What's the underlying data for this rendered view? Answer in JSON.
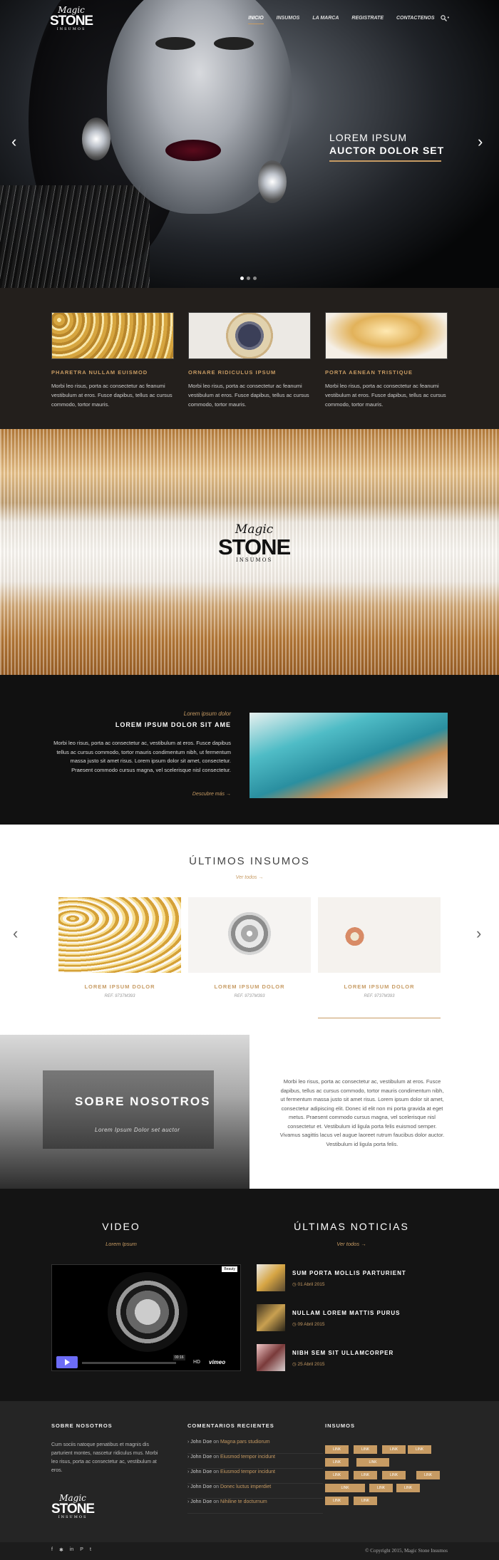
{
  "brand": {
    "line1": "Magic",
    "line2": "STONE",
    "line3": "INSUMOS"
  },
  "nav": {
    "items": [
      "INICIO",
      "INSUMOS",
      "LA MARCA",
      "REGISTRATE",
      "CONTACTENOS"
    ],
    "extra": "•"
  },
  "hero": {
    "title1": "LOREM IPSUM",
    "title2": "AUCTOR DOLOR SET",
    "prev": "‹",
    "next": "›"
  },
  "features": [
    {
      "title": "PHARETRA NULLAM EUISMOD",
      "text": "Morbi leo risus, porta ac consectetur ac feanumi vestibulum at eros. Fusce dapibus, tellus ac cursus commodo, tortor mauris."
    },
    {
      "title": "ORNARE RIDICULUS IPSUM",
      "text": "Morbi leo risus, porta ac consectetur ac feanumi vestibulum at eros. Fusce dapibus, tellus ac cursus commodo, tortor mauris."
    },
    {
      "title": "PORTA AENEAN TRISTIQUE",
      "text": "Morbi leo risus, porta ac consectetur ac feanumi vestibulum at eros. Fusce dapibus, tellus ac cursus commodo, tortor mauris."
    }
  ],
  "about": {
    "kicker": "Lorem ipsum dolor",
    "title": "LOREM IPSUM DOLOR SIT AME",
    "text": "Morbi leo risus, porta ac consectetur ac, vestibulum at eros. Fusce dapibus tellus ac cursus commodo, tortor mauris condimentum nibh, ut fermentum massa justo sit amet risus. Lorem ipsum dolor sit amet, consectetur. Praesent commodo cursus magna, vel scelerisque nisl consectetur.",
    "link": "Descubre más",
    "link_arrow": "→"
  },
  "latest": {
    "title": "ÚLTIMOS INSUMOS",
    "link": "Ver todos",
    "arrow": "→",
    "prev": "‹",
    "next": "›",
    "products": [
      {
        "name": "LOREM IPSUM DOLOR",
        "ref": "REF. 9737M393"
      },
      {
        "name": "LOREM IPSUM DOLOR",
        "ref": "REF. 9737M393"
      },
      {
        "name": "LOREM IPSUM DOLOR",
        "ref": "REF. 9737M393"
      }
    ]
  },
  "sobre": {
    "title": "SOBRE NOSOTROS",
    "subtitle": "Lorem Ipsum Dolor set auctor",
    "text": "Morbi leo risus, porta ac consectetur ac, vestibulum at eros. Fusce dapibus, tellus ac cursus commodo, tortor mauris condimentum nibh, ut fermentum massa justo sit amet risus. Lorem ipsum dolor sit amet, consectetur adipiscing elit. Donec id elit non mi porta gravida at eget metus. Praesent commodo cursus magna, vel scelerisque nisl consectetur et. Vestibulum id ligula porta felis euismod semper. Vivamus sagittis lacus vel augue laoreet rutrum faucibus dolor auctor. Vestibulum id ligula porta felis."
  },
  "video": {
    "title": "VIDEO",
    "subtitle": "Lorem Ipsum",
    "time": "00:16",
    "hd": "HD",
    "vimeo": "vimeo",
    "badge": "Beauty"
  },
  "news": {
    "title": "ÚLTIMAS NOTICIAS",
    "link": "Ver todos",
    "arrow": "→",
    "items": [
      {
        "title": "SUM PORTA MOLLIS PARTURIENT",
        "date": "01 Abril 2015"
      },
      {
        "title": "NULLAM LOREM MATTIS PURUS",
        "date": "09 Abril 2015"
      },
      {
        "title": "NIBH SEM SIT ULLAMCORPER",
        "date": "25 Abril 2015"
      }
    ]
  },
  "footer": {
    "about_title": "SOBRE NOSOTROS",
    "about_text": "Cum sociis natoque penatibus et magnis dis parturient montes, nascetur ridiculus mus. Morbi leo risus, porta ac consectetur ac, vestibulum at eros.",
    "comments_title": "COMENTARIOS RECIENTES",
    "comments": [
      {
        "author": "John Doe",
        "on": "on",
        "post": "Magna pars studiorum"
      },
      {
        "author": "John Doe",
        "on": "on",
        "post": "Eiusmod tempor incidunt"
      },
      {
        "author": "John Doe",
        "on": "on",
        "post": "Eiusmod tempor incidunt"
      },
      {
        "author": "John Doe",
        "on": "on",
        "post": "Donec luctus imperdiet"
      },
      {
        "author": "John Doe",
        "on": "on",
        "post": "Nihiline te docturnum"
      }
    ],
    "tags_title": "INSUMOS",
    "tag": "LINK",
    "copyright": "© Copyright 2015, Magic Stone Insumos",
    "social": [
      "f",
      "✱",
      "in",
      "P",
      "t"
    ]
  },
  "colors": {
    "accent": "#c79b63",
    "dark": "#111111"
  }
}
